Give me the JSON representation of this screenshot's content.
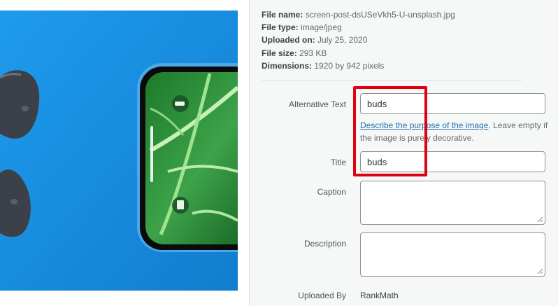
{
  "file_info": {
    "name_label": "File name:",
    "name_value": "screen-post-dsUSeVkh5-U-unsplash.jpg",
    "type_label": "File type:",
    "type_value": "image/jpeg",
    "uploaded_label": "Uploaded on:",
    "uploaded_value": "July 25, 2020",
    "size_label": "File size:",
    "size_value": "293 KB",
    "dimensions_label": "Dimensions:",
    "dimensions_value": "1920 by 942 pixels"
  },
  "form": {
    "alt_label": "Alternative Text",
    "alt_value": "buds",
    "alt_help_link": "Describe the purpose of the image",
    "alt_help_rest": ". Leave empty if the image is purely decorative.",
    "title_label": "Title",
    "title_value": "buds",
    "caption_label": "Caption",
    "caption_value": "",
    "description_label": "Description",
    "description_value": "",
    "uploaded_by_label": "Uploaded By",
    "uploaded_by_value": "RankMath"
  },
  "colors": {
    "photo_background": "#1a8fe0",
    "highlight_border": "#e0000f",
    "link": "#2271b1"
  }
}
